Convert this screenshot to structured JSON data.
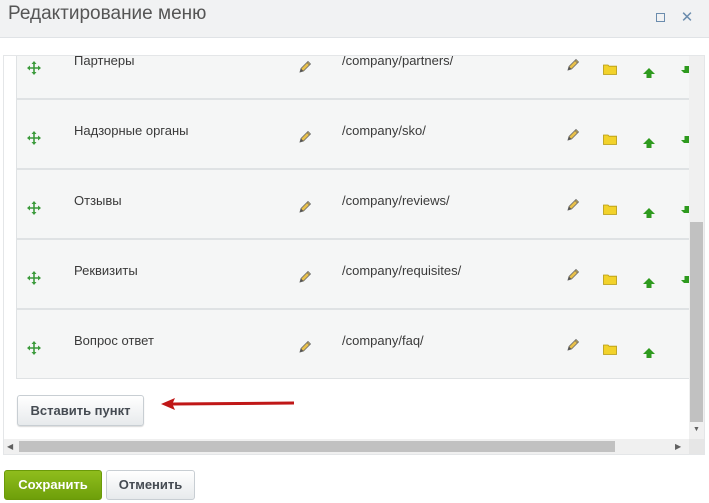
{
  "dialog": {
    "title": "Редактирование меню"
  },
  "menu_items": [
    {
      "name": "Партнеры",
      "url": "/company/partners/"
    },
    {
      "name": "Надзорные органы",
      "url": "/company/sko/"
    },
    {
      "name": "Отзывы",
      "url": "/company/reviews/"
    },
    {
      "name": "Реквизиты",
      "url": "/company/requisites/"
    },
    {
      "name": "Вопрос ответ",
      "url": "/company/faq/"
    }
  ],
  "actions": {
    "insert_label": "Вставить пункт",
    "save_label": "Сохранить",
    "cancel_label": "Отменить"
  },
  "icons": {
    "drag": "move-arrows-icon",
    "edit": "pencil-icon",
    "folder": "folder-icon",
    "up": "arrow-up-icon",
    "down": "arrow-down-icon",
    "annotation": "red-arrow-pointer"
  },
  "colors": {
    "save_button": "#7aab12",
    "arrow_up": "#2e9a1e",
    "annotation_arrow": "#c01717",
    "folder": "#f2d22a"
  }
}
